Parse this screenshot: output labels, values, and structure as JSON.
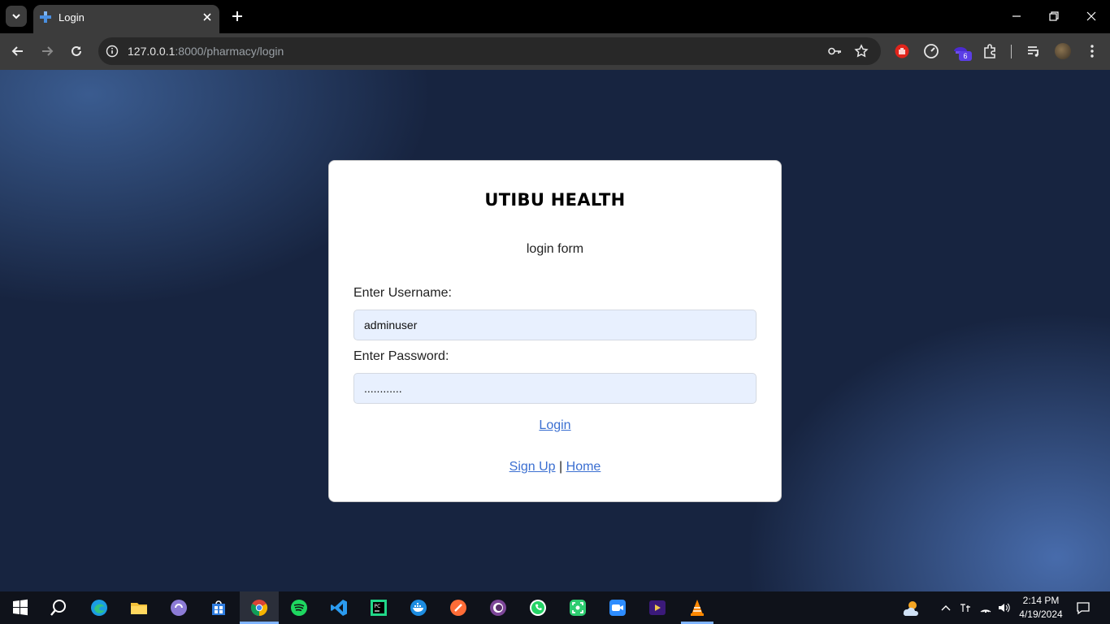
{
  "browser": {
    "tab": {
      "title": "Login",
      "favicon": "blue-cross-icon"
    },
    "address": {
      "host": "127.0.0.1",
      "rest": ":8000/pharmacy/login"
    },
    "extension_badge": "6"
  },
  "page": {
    "brand": "UTIBU HEALTH",
    "subtitle": "login form",
    "username": {
      "label": "Enter Username:",
      "value": "adminuser"
    },
    "password": {
      "label": "Enter Password:",
      "value": "............"
    },
    "login_link": "Login",
    "signup_link": "Sign Up",
    "separator": "|",
    "home_link": "Home"
  },
  "taskbar": {
    "apps": [
      "start",
      "search",
      "edge",
      "file-explorer",
      "torrent",
      "microsoft-store",
      "chrome",
      "spotify",
      "vscode",
      "pycharm",
      "docker",
      "postman",
      "tor-browser",
      "whatsapp",
      "screen-capture",
      "zoom",
      "video-editor",
      "vlc"
    ],
    "time": "2:14 PM",
    "date": "4/19/2024"
  },
  "colors": {
    "link": "#3b6fd1",
    "input_bg": "#e8f0fe",
    "page_bg": "#172440"
  }
}
